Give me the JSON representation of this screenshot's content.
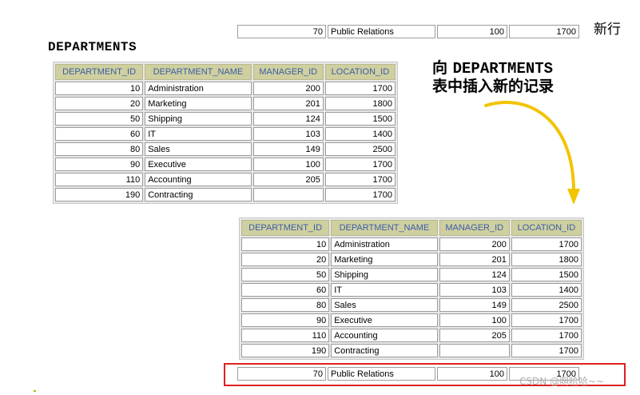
{
  "labels": {
    "departments_title": "DEPARTMENTS",
    "new_row": "新行",
    "caption_line1_prefix": "向 ",
    "caption_line1_table": "DEPARTMENTS",
    "caption_line2": "表中插入新的记录",
    "watermark": "CSDN @啊哈哈~~"
  },
  "columns": [
    "DEPARTMENT_ID",
    "DEPARTMENT_NAME",
    "MANAGER_ID",
    "LOCATION_ID"
  ],
  "new_row": {
    "id": "70",
    "name": "Public Relations",
    "manager": "100",
    "location": "1700"
  },
  "original_rows": [
    {
      "id": "10",
      "name": "Administration",
      "manager": "200",
      "location": "1700"
    },
    {
      "id": "20",
      "name": "Marketing",
      "manager": "201",
      "location": "1800"
    },
    {
      "id": "50",
      "name": "Shipping",
      "manager": "124",
      "location": "1500"
    },
    {
      "id": "60",
      "name": "IT",
      "manager": "103",
      "location": "1400"
    },
    {
      "id": "80",
      "name": "Sales",
      "manager": "149",
      "location": "2500"
    },
    {
      "id": "90",
      "name": "Executive",
      "manager": "100",
      "location": "1700"
    },
    {
      "id": "110",
      "name": "Accounting",
      "manager": "205",
      "location": "1700"
    },
    {
      "id": "190",
      "name": "Contracting",
      "manager": "",
      "location": "1700"
    }
  ],
  "result_rows": [
    {
      "id": "10",
      "name": "Administration",
      "manager": "200",
      "location": "1700"
    },
    {
      "id": "20",
      "name": "Marketing",
      "manager": "201",
      "location": "1800"
    },
    {
      "id": "50",
      "name": "Shipping",
      "manager": "124",
      "location": "1500"
    },
    {
      "id": "60",
      "name": "IT",
      "manager": "103",
      "location": "1400"
    },
    {
      "id": "80",
      "name": "Sales",
      "manager": "149",
      "location": "2500"
    },
    {
      "id": "90",
      "name": "Executive",
      "manager": "100",
      "location": "1700"
    },
    {
      "id": "110",
      "name": "Accounting",
      "manager": "205",
      "location": "1700"
    },
    {
      "id": "190",
      "name": "Contracting",
      "manager": "",
      "location": "1700"
    }
  ],
  "colors": {
    "header_bg": "#cfcf9f",
    "header_text": "#3a5ea8",
    "highlight": "#e02020",
    "arrow": "#f2c400"
  }
}
